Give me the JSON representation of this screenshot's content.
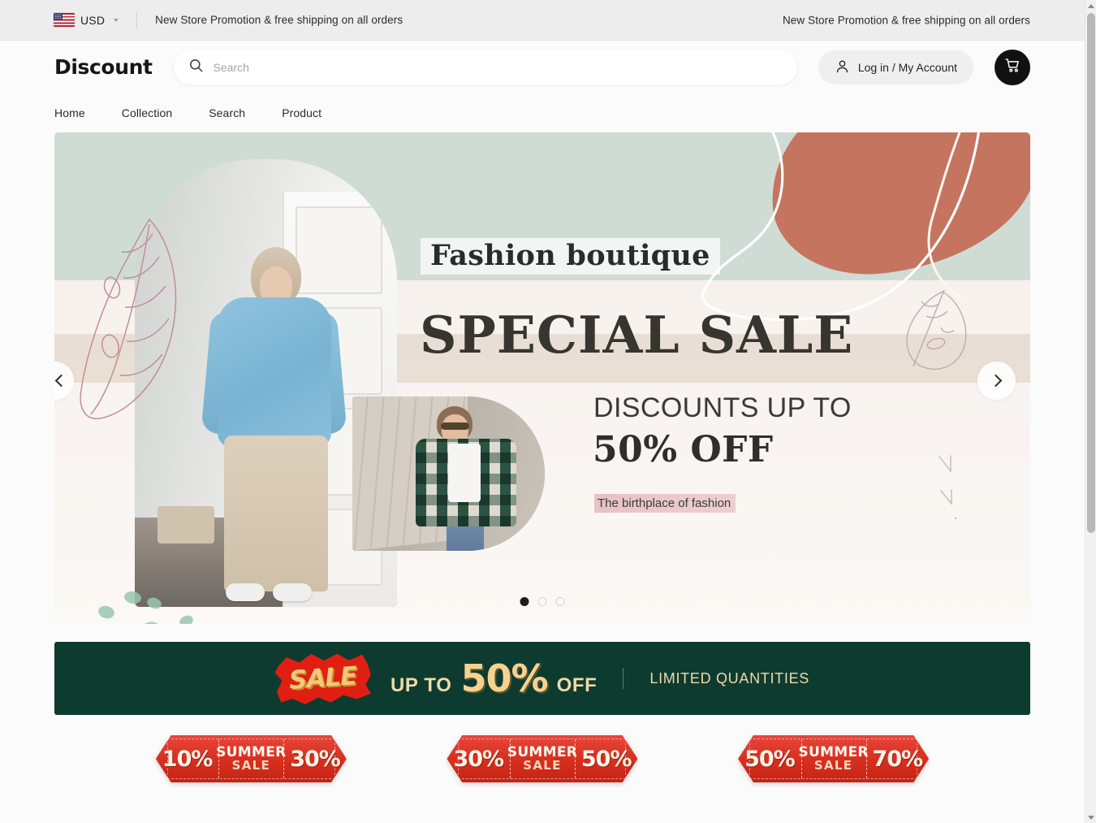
{
  "announcement": {
    "currency": "USD",
    "flag_icon": "us-flag-icon",
    "caret_icon": "chevron-down-icon",
    "message_left": "New Store Promotion & free shipping on all orders",
    "message_right": "New Store Promotion & free shipping on all orders"
  },
  "header": {
    "logo": "Discount",
    "search": {
      "icon": "search-icon",
      "value": "",
      "placeholder": "Search"
    },
    "account_label": "Log in / My Account",
    "account_icon": "user-icon",
    "cart_icon": "shopping-cart-icon"
  },
  "nav": {
    "items": [
      {
        "label": "Home"
      },
      {
        "label": "Collection"
      },
      {
        "label": "Search"
      },
      {
        "label": "Product"
      }
    ]
  },
  "hero": {
    "kicker": "Fashion boutique",
    "headline": "SPECIAL SALE",
    "subline_1": "DISCOUNTS UP TO",
    "subline_2": "50% OFF",
    "tagline": "The birthplace of fashion",
    "prev_icon": "chevron-left-icon",
    "next_icon": "chevron-right-icon",
    "slide_count": 3,
    "active_slide": 1,
    "colors": {
      "mint": "#cfdcd4",
      "terracotta": "#c4745f",
      "cream": "#f7f1ee",
      "beige_band": "#e6dbd0",
      "tagline_highlight": "#e2b0b6"
    }
  },
  "promo": {
    "badge_text": "SALE",
    "up_to": "UP TO",
    "percent": "50%",
    "off": "OFF",
    "limited": "LIMITED QUANTITIES",
    "background": "#0e3b30",
    "gold": "#f6d290"
  },
  "coupons": [
    {
      "left": "10%",
      "title": "SUMMER",
      "subtitle": "SALE",
      "right": "30%"
    },
    {
      "left": "30%",
      "title": "SUMMER",
      "subtitle": "SALE",
      "right": "50%"
    },
    {
      "left": "50%",
      "title": "SUMMER",
      "subtitle": "SALE",
      "right": "70%"
    }
  ],
  "scrollbar": {
    "up_icon": "scroll-up-arrow-icon",
    "down_icon": "scroll-down-arrow-icon"
  }
}
